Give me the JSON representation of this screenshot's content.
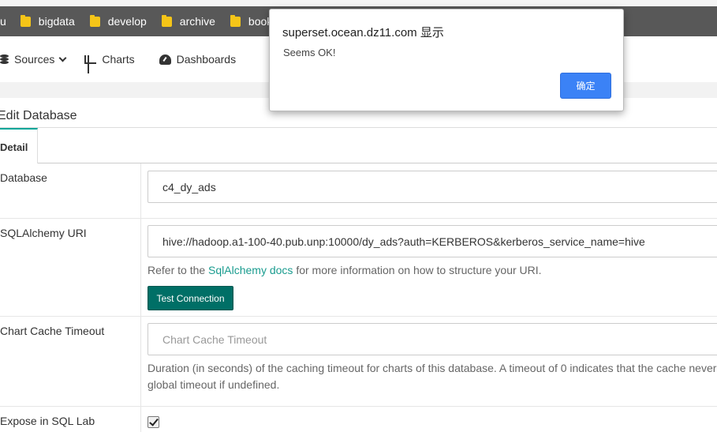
{
  "browser": {
    "bookmarks": [
      {
        "label": "bigdata"
      },
      {
        "label": "develop"
      },
      {
        "label": "archive"
      },
      {
        "label": "book"
      }
    ]
  },
  "nav": {
    "sources": "Sources",
    "charts": "Charts",
    "dashboards": "Dashboards"
  },
  "page": {
    "title": "Edit Database",
    "tab_detail": "Detail"
  },
  "form": {
    "database": {
      "label": "Database",
      "value": "c4_dy_ads"
    },
    "sqlalchemy_uri": {
      "label": "SQLAlchemy URI",
      "value": "hive://hadoop.a1-100-40.pub.unp:10000/dy_ads?auth=KERBEROS&kerberos_service_name=hive",
      "help_prefix": "Refer to the ",
      "help_link": "SqlAlchemy docs",
      "help_suffix": " for more information on how to structure your URI.",
      "test_button": "Test Connection"
    },
    "chart_cache_timeout": {
      "label": "Chart Cache Timeout",
      "placeholder": "Chart Cache Timeout",
      "help_line1": "Duration (in seconds) of the caching timeout for charts of this database. A timeout of 0 indicates that the cache never",
      "help_line2": "global timeout if undefined."
    },
    "expose_in_sql_lab": {
      "label": "Expose in SQL Lab",
      "checked": true
    }
  },
  "dialog": {
    "title": "superset.ocean.dz11.com 显示",
    "message": "Seems OK!",
    "ok": "确定"
  },
  "colors": {
    "accent": "#00a699",
    "button_primary": "#006f66",
    "dialog_button": "#3b82f6",
    "bookmark_bar": "#585858"
  }
}
